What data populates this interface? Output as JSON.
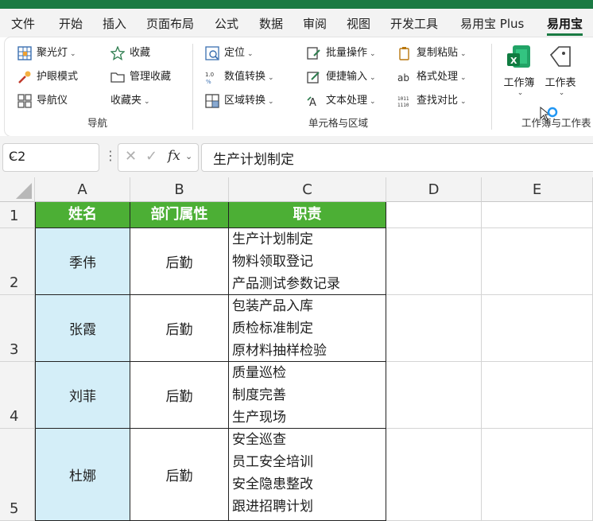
{
  "tabs": [
    "文件",
    "开始",
    "插入",
    "页面布局",
    "公式",
    "数据",
    "审阅",
    "视图",
    "开发工具",
    "易用宝 Plus",
    "易用宝"
  ],
  "ribbon": {
    "nav": {
      "items": [
        {
          "label": "聚光灯",
          "icon": "spotlight-grid-icon"
        },
        {
          "label": "收藏",
          "icon": "star-icon"
        },
        {
          "label": "护眼模式",
          "icon": "eye-care-icon"
        },
        {
          "label": "管理收藏",
          "icon": "folder-icon"
        },
        {
          "label": "导航仪",
          "icon": "navigator-grid-icon"
        },
        {
          "label": "收藏夹",
          "icon": "favorites-icon"
        }
      ],
      "group_label": "导航"
    },
    "cell_area": {
      "items": [
        {
          "label": "定位",
          "icon": "locate-icon"
        },
        {
          "label": "批量操作",
          "icon": "batch-icon"
        },
        {
          "label": "复制粘贴",
          "icon": "copy-paste-icon"
        },
        {
          "label": "数值转换",
          "icon": "number-convert-icon"
        },
        {
          "label": "便捷输入",
          "icon": "quick-input-icon"
        },
        {
          "label": "格式处理",
          "icon": "format-icon"
        },
        {
          "label": "区域转换",
          "icon": "range-convert-icon"
        },
        {
          "label": "文本处理",
          "icon": "text-process-icon"
        },
        {
          "label": "查找对比",
          "icon": "find-compare-icon"
        }
      ],
      "group_label": "单元格与区域"
    },
    "workbook": {
      "items": [
        {
          "label": "工作簿",
          "icon": "excel-workbook-icon"
        },
        {
          "label": "工作表",
          "icon": "worksheet-tag-icon"
        }
      ],
      "group_label": "工作簿与工作表"
    }
  },
  "formula_bar": {
    "name_box": "C2",
    "formula": "生产计划制定"
  },
  "columns": [
    "A",
    "B",
    "C",
    "D",
    "E"
  ],
  "rows": [
    "1",
    "2",
    "3",
    "4",
    "5"
  ],
  "table": {
    "headers": [
      "姓名",
      "部门属性",
      "职责"
    ],
    "records": [
      {
        "name": "季伟",
        "dept": "后勤",
        "duties": [
          "生产计划制定",
          "物料领取登记",
          "产品测试参数记录"
        ]
      },
      {
        "name": "张霞",
        "dept": "后勤",
        "duties": [
          "包装产品入库",
          "质检标准制定",
          "原材料抽样检验"
        ]
      },
      {
        "name": "刘菲",
        "dept": "后勤",
        "duties": [
          "质量巡检",
          "制度完善",
          "生产现场"
        ]
      },
      {
        "name": "杜娜",
        "dept": "后勤",
        "duties": [
          "安全巡查",
          "员工安全培训",
          "安全隐患整改",
          "跟进招聘计划"
        ]
      }
    ]
  },
  "colors": {
    "header_green": "#4caf35",
    "name_fill": "#d4eef8",
    "title_strip": "#1a7a43"
  }
}
